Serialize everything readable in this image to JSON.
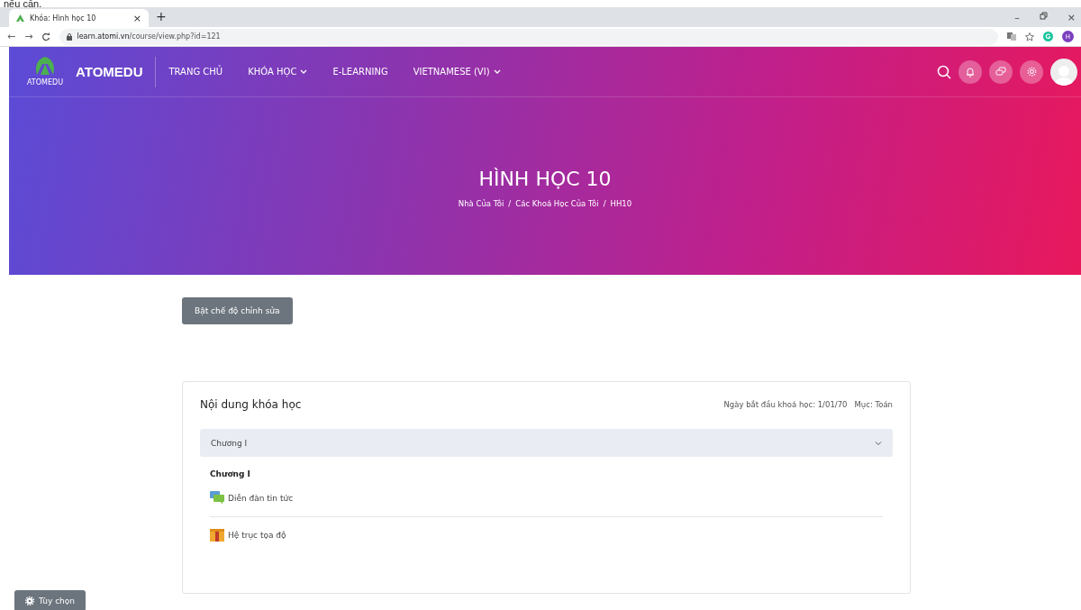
{
  "caption": "nếu cần.",
  "browser": {
    "back": "←",
    "forward": "→",
    "tab_title": "Khóa: Hình học 10",
    "tab_close": "×",
    "new_tab": "+",
    "url_host": "learn.atomi.vn",
    "url_path": "/course/view.php?id=121",
    "profile_initial": "H",
    "minimize": "–",
    "close": "×"
  },
  "navbar": {
    "brand": "ATOMEDU",
    "brand_sub": "ATOMEDU",
    "items": [
      {
        "label": "TRANG CHỦ",
        "dropdown": false
      },
      {
        "label": "KHÓA HỌC",
        "dropdown": true
      },
      {
        "label": "E-LEARNING",
        "dropdown": false
      },
      {
        "label": "VIETNAMESE (VI)",
        "dropdown": true
      }
    ]
  },
  "hero": {
    "title": "HÌNH HỌC 10",
    "breadcrumb": [
      "Nhà Của Tôi",
      "Các Khoá Học Của Tôi",
      "HH10"
    ],
    "separator": "/"
  },
  "edit_button": "Bật chế độ chỉnh sửa",
  "course": {
    "title": "Nội dung khóa học",
    "start_date": "Ngày bắt đầu khoá học: 1/01/70",
    "category": "Mục: Toán",
    "section": {
      "header": "Chương I",
      "expanded": true,
      "name": "Chương I",
      "activities": [
        {
          "kind": "forum",
          "label": "Diễn đàn tin tức"
        },
        {
          "kind": "resource",
          "label": "Hệ trục tọa độ"
        }
      ]
    }
  },
  "options_button": "Tùy chọn"
}
